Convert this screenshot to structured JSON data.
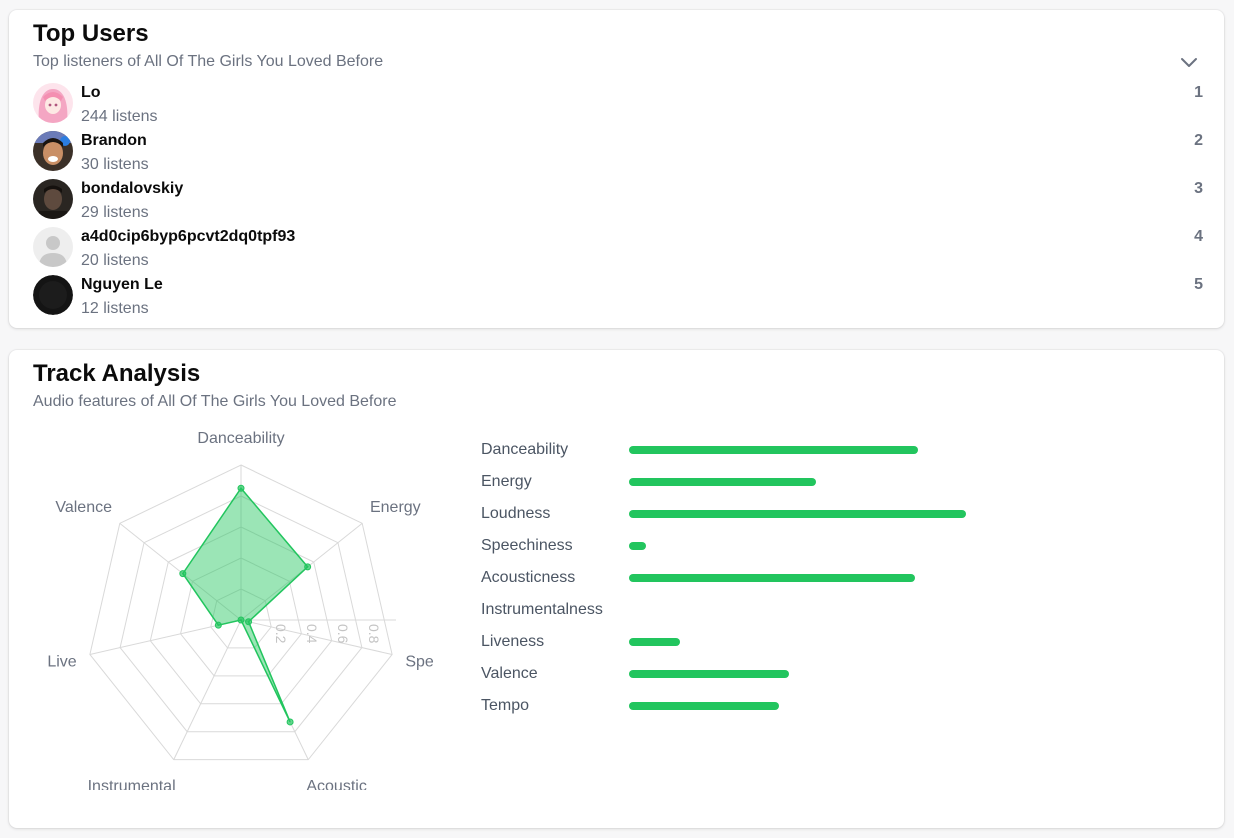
{
  "top_users": {
    "title": "Top Users",
    "subtitle": "Top listeners of All Of The Girls You Loved Before",
    "collapse_icon": "chevron-down-icon",
    "users": [
      {
        "name": "Lo",
        "listens": "244 listens",
        "rank": "1",
        "avatar": "anime-avatar"
      },
      {
        "name": "Brandon",
        "listens": "30 listens",
        "rank": "2",
        "avatar": "photo-avatar"
      },
      {
        "name": "bondalovskiy",
        "listens": "29 listens",
        "rank": "3",
        "avatar": "photo-avatar"
      },
      {
        "name": "a4d0cip6byp6pcvt2dq0tpf93",
        "listens": "20 listens",
        "rank": "4",
        "avatar": "default-person-avatar"
      },
      {
        "name": "Nguyen Le",
        "listens": "12 listens",
        "rank": "5",
        "avatar": "dark-avatar"
      }
    ]
  },
  "track_analysis": {
    "title": "Track Analysis",
    "subtitle": "Audio features of All Of The Girls You Loved Before",
    "accent_color": "#22c55e",
    "radar": {
      "axes": [
        "Danceability",
        "Energy",
        "Speechiness",
        "Acousticness",
        "Instrumentalness",
        "Liveness",
        "Valence"
      ],
      "axis_labels": [
        "Danceability",
        "Energy",
        "Speec",
        "Acoustic",
        "Instrumental",
        "Live",
        "Valence"
      ],
      "ticks": [
        "0.2",
        "0.4",
        "0.6",
        "0.8"
      ],
      "values": [
        0.85,
        0.55,
        0.05,
        0.73,
        0.0,
        0.15,
        0.48
      ],
      "max": 1.0
    },
    "bars": [
      {
        "label": "Danceability",
        "value": 0.85
      },
      {
        "label": "Energy",
        "value": 0.55
      },
      {
        "label": "Loudness",
        "value": 0.99
      },
      {
        "label": "Speechiness",
        "value": 0.05
      },
      {
        "label": "Acousticness",
        "value": 0.84
      },
      {
        "label": "Instrumentalness",
        "value": 0.0
      },
      {
        "label": "Liveness",
        "value": 0.15
      },
      {
        "label": "Valence",
        "value": 0.47
      },
      {
        "label": "Tempo",
        "value": 0.44
      }
    ]
  }
}
